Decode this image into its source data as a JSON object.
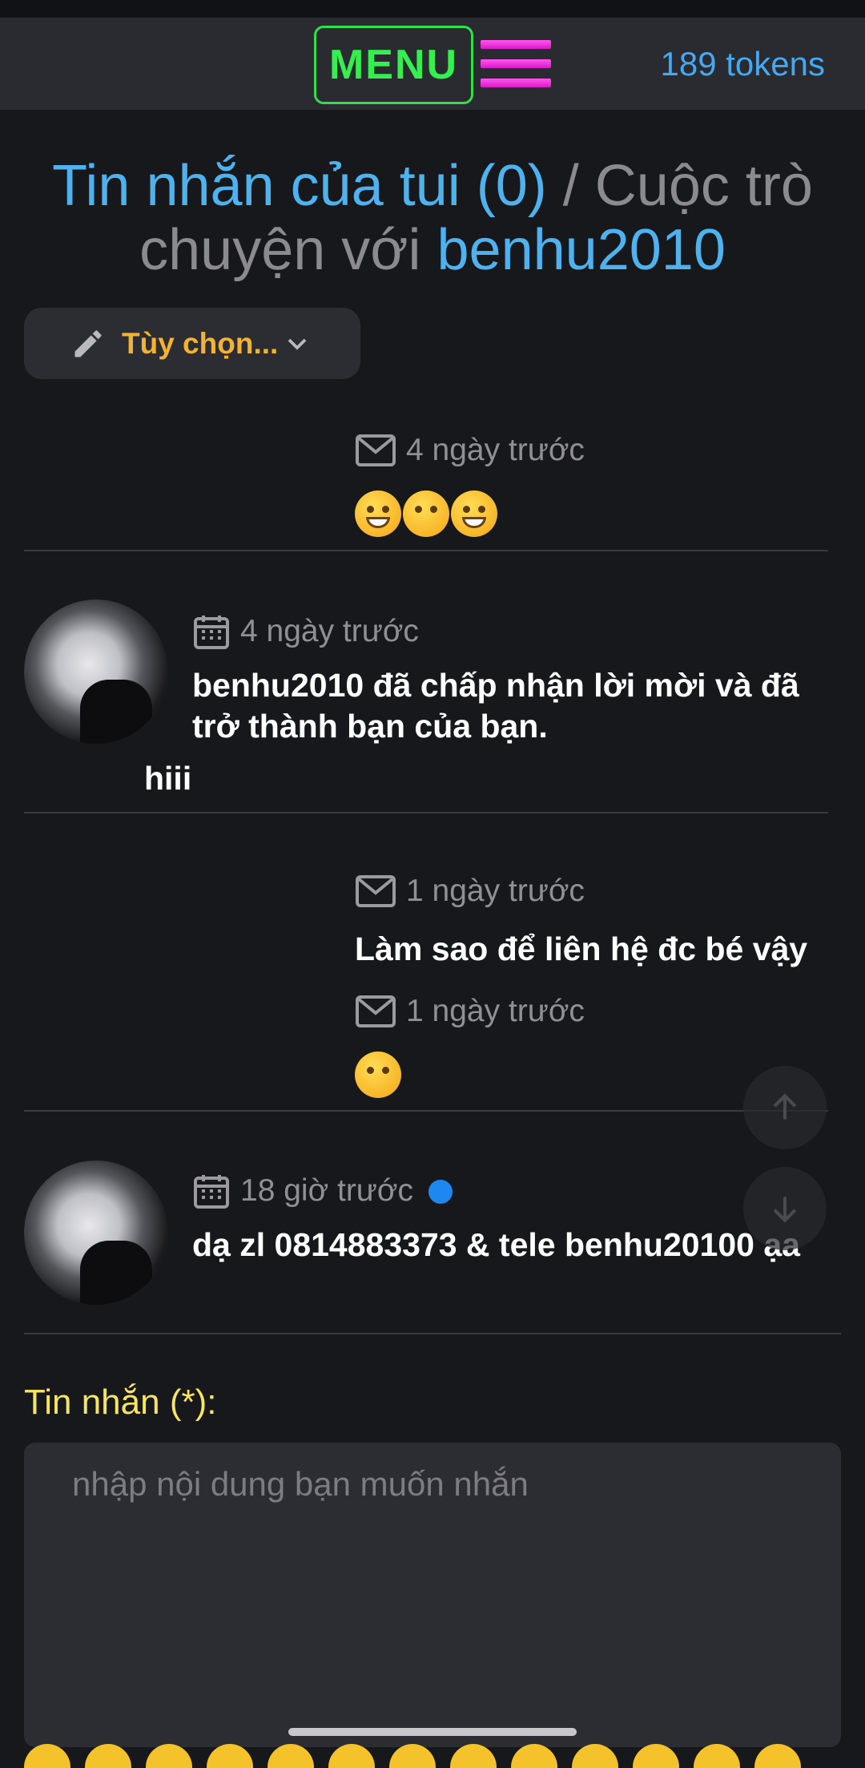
{
  "header": {
    "menu_label": "MENU",
    "tokens": "189 tokens"
  },
  "title": {
    "inbox_link": "Tin nhắn của tui (0)",
    "separator": " / Cuộc trò chuyện với ",
    "partner_link": "benhu2010"
  },
  "options": {
    "label": "Tùy chọn..."
  },
  "messages": [
    {
      "time": "4 ngày trước",
      "text": "😅😘😅",
      "type": "sent"
    },
    {
      "time": "4 ngày trước",
      "text": "benhu2010 đã chấp nhận lời mời và đã trở thành bạn của bạn.",
      "subtext": "hiii",
      "type": "received"
    },
    {
      "time": "1 ngày trước",
      "text": "Làm sao để liên hệ đc bé vậy",
      "type": "sent"
    },
    {
      "time": "1 ngày trước",
      "text": "😊",
      "type": "sent"
    },
    {
      "time": "18 giờ trước",
      "text": "dạ zl 0814883373 & tele benhu20100 ạa",
      "type": "received",
      "unread": true
    }
  ],
  "form": {
    "label": "Tin nhắn (*):",
    "placeholder": "nhập nội dung bạn muốn nhắn"
  },
  "colors": {
    "background": "#17181c",
    "topbar": "#2a2b30",
    "menu_green": "#35ee4f",
    "hamburger_pink": "#ff55ee",
    "link_blue": "#4eb2ef",
    "options_orange": "#f2b233",
    "label_yellow": "#f7e463",
    "unread_dot": "#1e88f0"
  }
}
